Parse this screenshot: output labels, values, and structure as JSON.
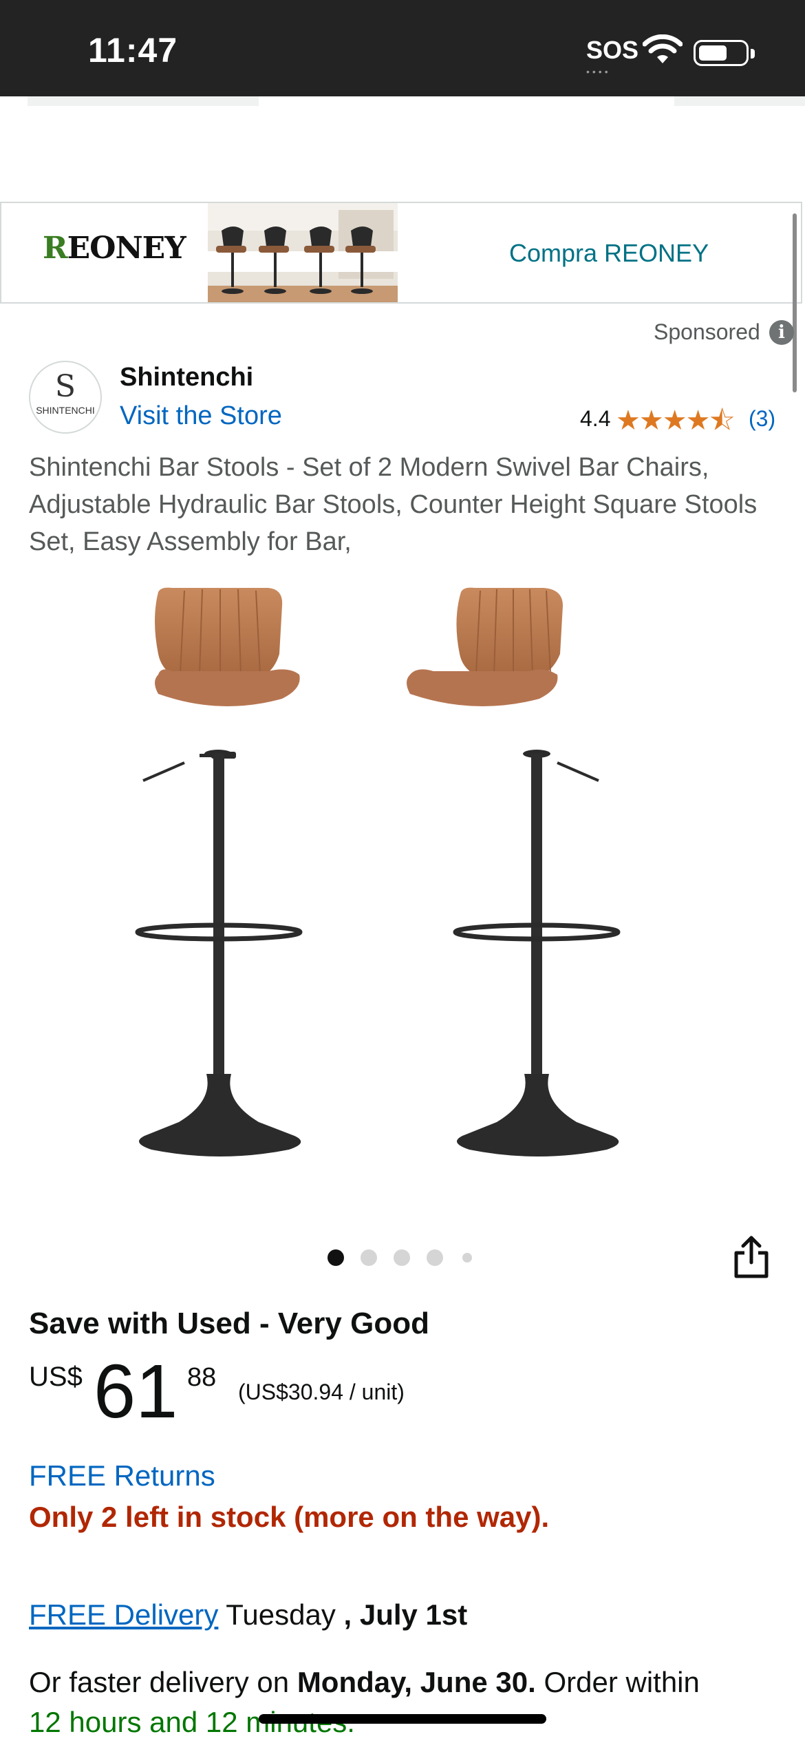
{
  "status_bar": {
    "time": "11:47",
    "sos": "SOS"
  },
  "sponsored_banner": {
    "brand": "REONEY",
    "cta": "Compra REONEY"
  },
  "sponsored": {
    "label": "Sponsored"
  },
  "store": {
    "name": "Shintenchi",
    "logo_letter": "S",
    "logo_text": "SHINTENCHI",
    "link": "Visit the Store",
    "rating": "4.4",
    "stars": "★★★★⯪",
    "rating_count": "(3)"
  },
  "product": {
    "title": "Shintenchi Bar Stools - Set of 2 Modern Swivel Bar Chairs, Adjustable Hydraulic Bar Stools, Counter Height Square Stools Set, Easy Assembly for Bar,",
    "image_count": 5,
    "active_image": 0
  },
  "offer": {
    "heading": "Save with Used - Very Good",
    "currency": "US$",
    "price_whole": "61",
    "price_fraction": "88",
    "unit_price": "(US$30.94",
    "unit_suffix": " / unit)",
    "returns": "FREE Returns",
    "stock": "Only 2 left in stock (more on the way)."
  },
  "delivery": {
    "link": "FREE Delivery",
    "day": " Tuesday ",
    "date": ", July 1st",
    "faster_prefix": "Or faster delivery on ",
    "faster_date": "Monday, June 30.",
    "faster_suffix": " Order within",
    "countdown": "12 hours and 12 minutes."
  },
  "colors": {
    "link": "#0066c0",
    "teal": "#007185",
    "star": "#de7921",
    "stock": "#b12704",
    "green": "#007600"
  }
}
